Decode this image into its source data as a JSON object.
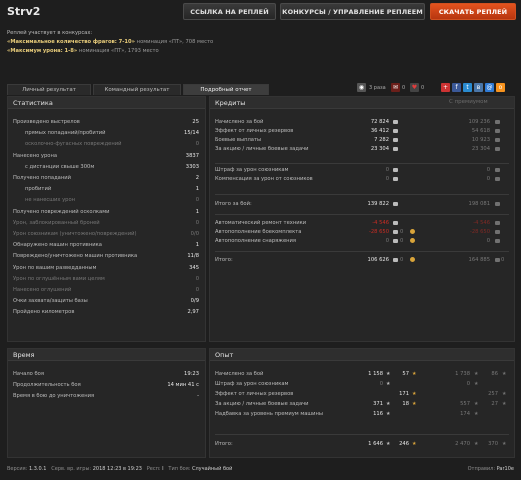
{
  "header": {
    "title": "Strv2",
    "btn_link": "ССЫЛКА НА РЕПЛЕЙ",
    "btn_contests": "КОНКУРСЫ / УПРАВЛЕНИЕ РЕПЛЕЕМ",
    "btn_download": "СКАЧАТЬ РЕПЛЕЙ"
  },
  "contest": {
    "intro": "Реплей участвует в конкурсах:",
    "c1_name": "«Максимальное количество фрагов: 7-10»",
    "c1_rest": "номинация «ПТ», 708 место",
    "c2_name": "«Максимум урона: 1-8»",
    "c2_rest": "номинация «ПТ», 1793 место"
  },
  "tabs": [
    "Личный результат",
    "Командный результат",
    "Подробный отчет"
  ],
  "meta": {
    "views": "3 раза",
    "comments": "0",
    "likes": "0"
  },
  "stats": {
    "title": "Статистика",
    "rows": [
      {
        "label": "Произведено выстрелов",
        "value": "25",
        "indent": 0
      },
      {
        "label": "прямых попаданий/пробитий",
        "value": "15/14",
        "indent": 1
      },
      {
        "label": "осколочно-фугасных повреждений",
        "value": "0",
        "indent": 1,
        "dim": true
      },
      {
        "label": "Нанесено урона",
        "value": "3837",
        "indent": 0
      },
      {
        "label": "с дистанции свыше 300м",
        "value": "3303",
        "indent": 1
      },
      {
        "label": "Получено попаданий",
        "value": "2",
        "indent": 0
      },
      {
        "label": "пробитий",
        "value": "1",
        "indent": 1
      },
      {
        "label": "не нанесших урон",
        "value": "0",
        "indent": 1,
        "dim": true
      },
      {
        "label": "Получено повреждений осколками",
        "value": "1",
        "indent": 0
      },
      {
        "label": "Урон, заблокированный броней",
        "value": "0",
        "indent": 0,
        "dim": true
      },
      {
        "label": "Урон союзникам (уничтожено/повреждений)",
        "value": "0/0",
        "indent": 0,
        "dim": true
      },
      {
        "label": "Обнаружено машин противника",
        "value": "1",
        "indent": 0
      },
      {
        "label": "Повреждено/уничтожено машин противника",
        "value": "11/8",
        "indent": 0
      },
      {
        "label": "Урон по вашим разведданным",
        "value": "345",
        "indent": 0
      },
      {
        "label": "Урон по оглушённым вами целям",
        "value": "0",
        "indent": 0,
        "dim": true
      },
      {
        "label": "Нанесено оглушений",
        "value": "0",
        "indent": 0,
        "dim": true
      },
      {
        "label": "Очки захвата/защиты базы",
        "value": "0/9",
        "indent": 0
      },
      {
        "label": "Пройдено километров",
        "value": "2,97",
        "indent": 0
      }
    ]
  },
  "credits": {
    "title": "Кредиты",
    "premium_label": "С премиумом",
    "rows": [
      {
        "label": "Начислено за бой",
        "value": "72 824",
        "prem": "109 236"
      },
      {
        "label": "Эффект от личных резервов",
        "value": "36 412",
        "prem": "54 618"
      },
      {
        "label": "Боевые выплаты",
        "value": "7 282",
        "prem": "10 923"
      },
      {
        "label": "За акцию / личные боевые задачи",
        "value": "23 304",
        "prem": "23 304"
      },
      {
        "label": "Штраф за урон союзникам",
        "value": "0",
        "prem": "0"
      },
      {
        "label": "Компенсация за урон от союзников",
        "value": "0",
        "prem": "0"
      },
      {
        "label": "Итого за бой:",
        "value": "139 822",
        "prem": "198 081"
      },
      {
        "label": "Автоматический ремонт техники",
        "value": "-4 546",
        "prem": "-4 546",
        "red": true
      },
      {
        "label": "Автопополнение боекомплекта",
        "value": "-28 650",
        "gold": "0",
        "prem": "-28 650",
        "red": true
      },
      {
        "label": "Автопополнение снаряжения",
        "value": "0",
        "gold": "0",
        "prem": "0"
      },
      {
        "label": "Итого:",
        "value": "106 626",
        "gold": "0",
        "prem": "164 885",
        "prem_gold": "0"
      }
    ]
  },
  "time": {
    "title": "Время",
    "rows": [
      {
        "label": "Начало боя",
        "value": "19:23"
      },
      {
        "label": "Продолжительность боя",
        "value": "14 мин 41 с"
      },
      {
        "label": "Время в бою до уничтожения",
        "value": "-"
      }
    ]
  },
  "exp": {
    "title": "Опыт",
    "rows": [
      {
        "label": "Начислено за бой",
        "xp": "1 158",
        "fxp": "57",
        "pxp": "1 738",
        "pfxp": "86"
      },
      {
        "label": "Штраф за урон союзникам",
        "xp": "0",
        "fxp": "",
        "pxp": "0",
        "pfxp": ""
      },
      {
        "label": "Эффект от личных резервов",
        "xp": "",
        "fxp": "171",
        "pxp": "",
        "pfxp": "257"
      },
      {
        "label": "За акцию / личные боевые задачи",
        "xp": "371",
        "fxp": "18",
        "pxp": "557",
        "pfxp": "27"
      },
      {
        "label": "Надбавка за уровень премиум машины",
        "xp": "116",
        "fxp": "",
        "pxp": "174",
        "pfxp": ""
      },
      {
        "label": "Итого:",
        "xp": "1 646",
        "fxp": "246",
        "pxp": "2 470",
        "pfxp": "370"
      }
    ]
  },
  "footer": {
    "version_label": "Версия:",
    "version": "1.3.0.1",
    "server_label": "Серв. вр. игры:",
    "server": "2018 12:23 в 19:23",
    "result_label": "Респ:",
    "result": "I",
    "type_label": "Тип боя:",
    "type": "Случайный бой",
    "sender_label": "Отправил:",
    "sender": "Par10e"
  }
}
